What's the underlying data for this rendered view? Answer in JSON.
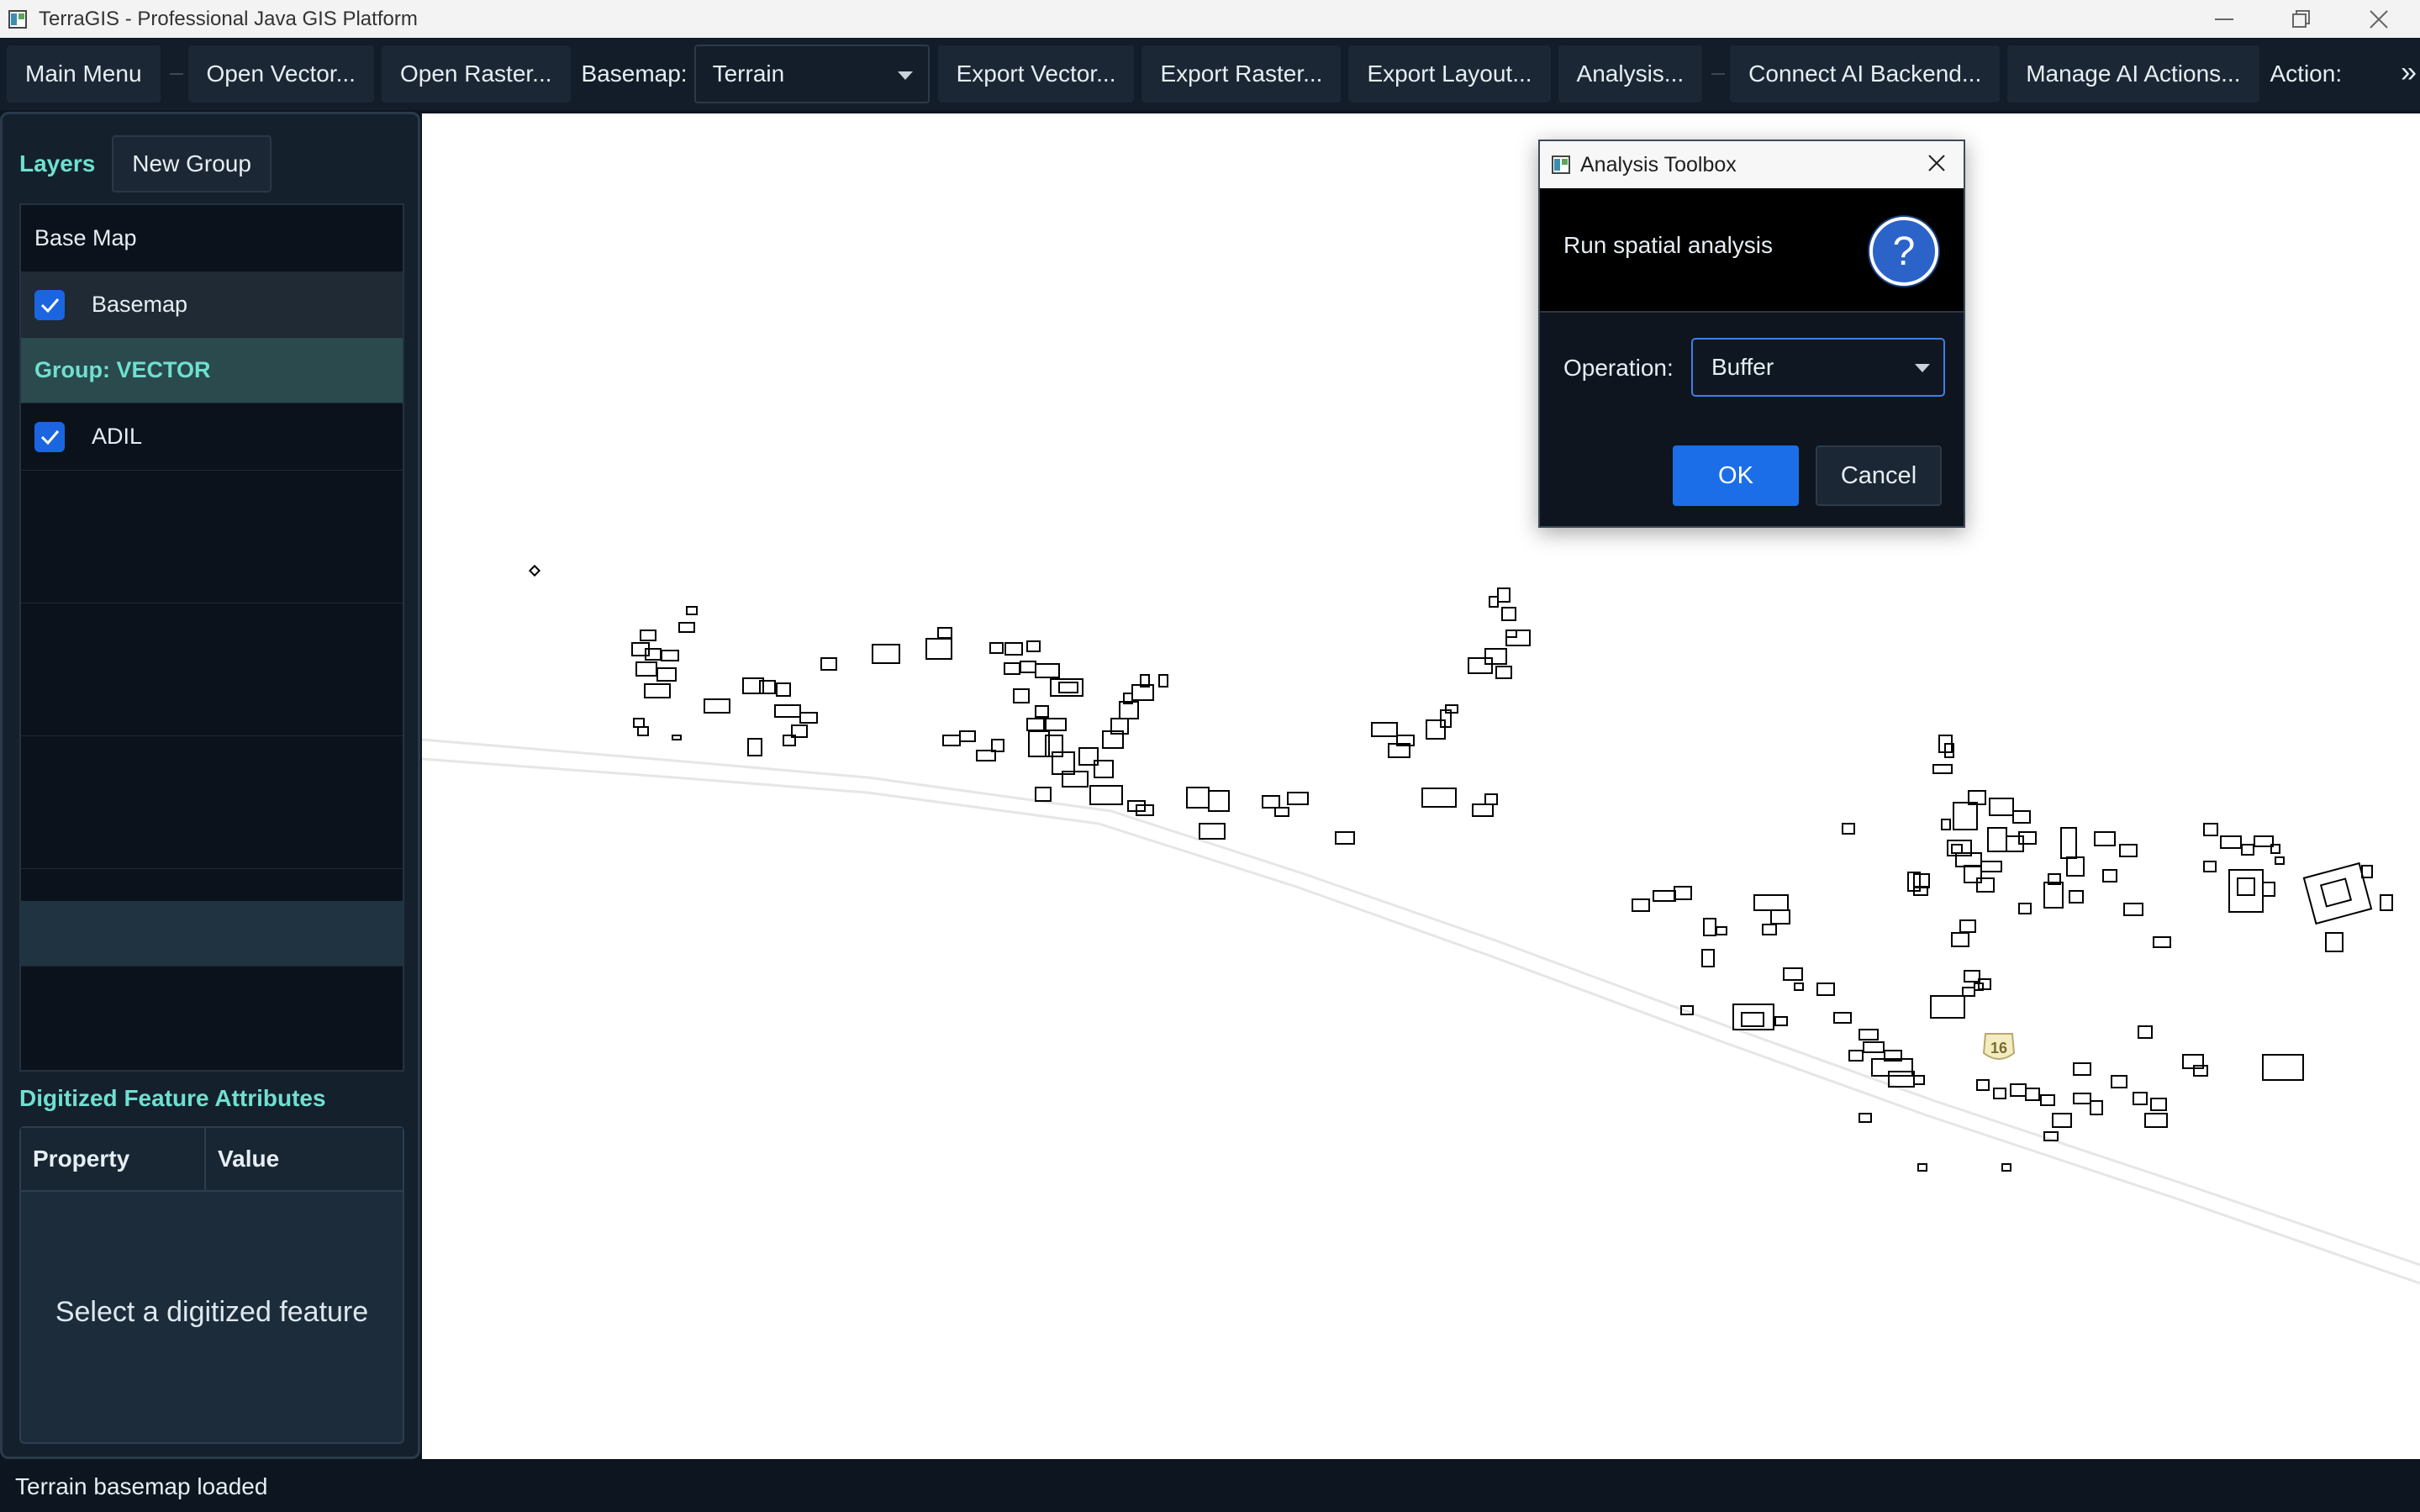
{
  "window": {
    "title": "TerraGIS - Professional Java GIS Platform"
  },
  "toolbar": {
    "main_menu": "Main Menu",
    "open_vector": "Open Vector...",
    "open_raster": "Open Raster...",
    "basemap_label": "Basemap:",
    "basemap_value": "Terrain",
    "export_vector": "Export Vector...",
    "export_raster": "Export Raster...",
    "export_layout": "Export Layout...",
    "analysis": "Analysis...",
    "connect_ai": "Connect AI Backend...",
    "manage_ai": "Manage AI Actions...",
    "action_label": "Action:",
    "overflow": "»"
  },
  "layers": {
    "title": "Layers",
    "new_group": "New Group",
    "groups": [
      {
        "name": "Base Map",
        "layers": [
          {
            "name": "Basemap",
            "checked": true
          }
        ]
      },
      {
        "name": "Group: VECTOR",
        "layers": [
          {
            "name": "ADIL",
            "checked": true
          }
        ]
      }
    ]
  },
  "attributes": {
    "title": "Digitized Feature Attributes",
    "col_property": "Property",
    "col_value": "Value",
    "empty": "Select a digitized feature"
  },
  "map": {
    "road_label": "16"
  },
  "dialog": {
    "title": "Analysis Toolbox",
    "message": "Run spatial analysis",
    "operation_label": "Operation:",
    "operation_value": "Buffer",
    "ok": "OK",
    "cancel": "Cancel"
  },
  "status": {
    "text": "Terrain basemap loaded"
  },
  "colors": {
    "accent": "#6fe0d0",
    "primary_button": "#1b6ee8",
    "panel_bg": "#14202c"
  }
}
